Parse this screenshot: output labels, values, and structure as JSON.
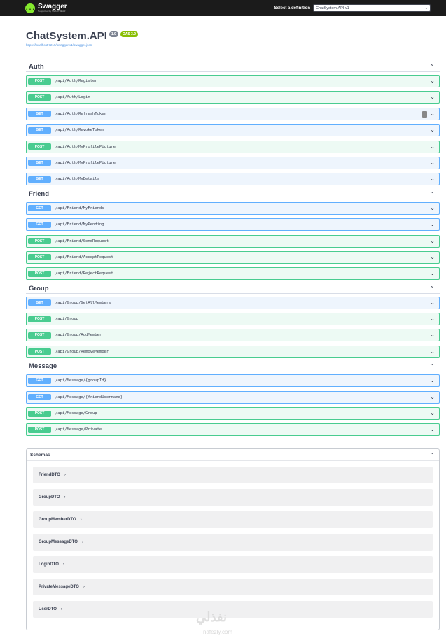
{
  "topbar": {
    "brand_logo": "{...}",
    "brand_name": "Swagger",
    "brand_sub": "Supported by SMARTBEAR",
    "definition_label": "Select a definition",
    "definition_value": "ChatSystem.API v1",
    "chevron": "⌄"
  },
  "info": {
    "title": "ChatSystem.API",
    "version": "1.0",
    "oas": "OAS 3.0",
    "url": "https://localhost:7219/swagger/v1/swagger.json"
  },
  "tags": [
    {
      "name": "Auth",
      "ops": [
        {
          "method": "POST",
          "path": "/api/Auth/Register"
        },
        {
          "method": "POST",
          "path": "/api/Auth/Login"
        },
        {
          "method": "GET",
          "path": "/api/Auth/RefreshToken"
        },
        {
          "method": "GET",
          "path": "/api/Auth/RevokeToken"
        },
        {
          "method": "POST",
          "path": "/api/Auth/MyProfilePicture"
        },
        {
          "method": "GET",
          "path": "/api/Auth/MyProfilePicture"
        },
        {
          "method": "GET",
          "path": "/api/Auth/MyDetails"
        }
      ]
    },
    {
      "name": "Friend",
      "ops": [
        {
          "method": "GET",
          "path": "/api/Friend/MyFriends"
        },
        {
          "method": "GET",
          "path": "/api/Friend/MyPending"
        },
        {
          "method": "POST",
          "path": "/api/Friend/SendRequest"
        },
        {
          "method": "POST",
          "path": "/api/Friend/AcceptRequest"
        },
        {
          "method": "POST",
          "path": "/api/Friend/RejectRequest"
        }
      ]
    },
    {
      "name": "Group",
      "ops": [
        {
          "method": "GET",
          "path": "/api/Group/GetAllMembers"
        },
        {
          "method": "POST",
          "path": "/api/Group"
        },
        {
          "method": "POST",
          "path": "/api/Group/AddMember"
        },
        {
          "method": "POST",
          "path": "/api/Group/RemoveMember"
        }
      ]
    },
    {
      "name": "Message",
      "ops": [
        {
          "method": "GET",
          "path": "/api/Message/{groupId}"
        },
        {
          "method": "GET",
          "path": "/api/Message/{friendUsername}"
        },
        {
          "method": "POST",
          "path": "/api/Message/Group"
        },
        {
          "method": "POST",
          "path": "/api/Message/Private"
        }
      ]
    }
  ],
  "schemas": {
    "title": "Schemas",
    "items": [
      "FriendDTO",
      "GroupDTO",
      "GroupMemberDTO",
      "GroupMessageDTO",
      "LoginDTO",
      "PrivateMessageDTO",
      "UserDTO"
    ]
  },
  "icons": {
    "collapse": "⌃",
    "expand": "⌄",
    "schema_expand": "›",
    "lock": "🔒"
  },
  "watermark": {
    "main": "نفذلي",
    "sub": "nafezly.com"
  },
  "colors": {
    "post": "#49cc90",
    "get": "#61affe",
    "topbar": "#1b1b1b",
    "brand_accent": "#85ea2d",
    "oas_badge": "#89bf04"
  }
}
